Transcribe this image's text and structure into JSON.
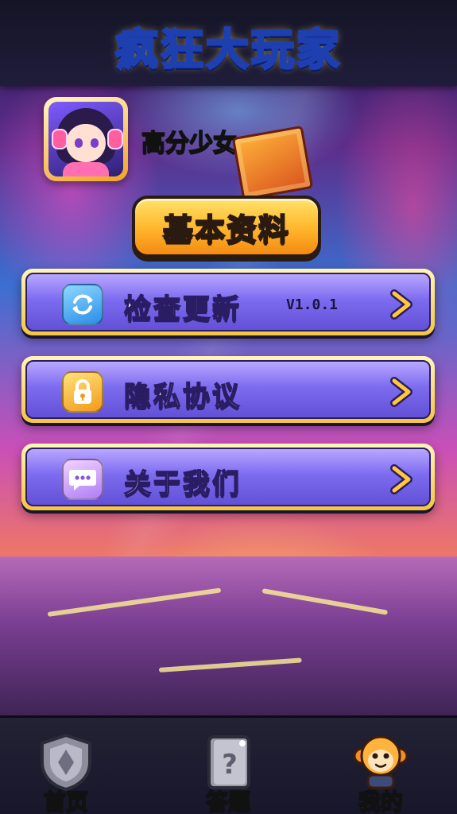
{
  "header": {
    "title": "疯狂大玩家"
  },
  "profile": {
    "username": "高分少女",
    "basic_info_label": "基本资料"
  },
  "menu": [
    {
      "label": "检查更新",
      "extra": "V1.0.1",
      "icon": "refresh-icon",
      "icon_color": "#3aa6f5"
    },
    {
      "label": "隐私协议",
      "extra": "",
      "icon": "lock-icon",
      "icon_color": "#ffbf2b"
    },
    {
      "label": "关于我们",
      "extra": "",
      "icon": "chat-icon",
      "icon_color": "#c58bff"
    }
  ],
  "bottom_nav": [
    {
      "label": "首页",
      "icon": "home-shield-icon",
      "active": false
    },
    {
      "label": "答题",
      "icon": "quiz-book-icon",
      "active": false
    },
    {
      "label": "我的",
      "icon": "monkey-avatar-icon",
      "active": true
    }
  ],
  "colors": {
    "title_fill": "#ffd34d",
    "title_stroke": "#1d3fb0",
    "menu_frame": "#f3c640",
    "menu_fill": "#7d6cf0",
    "button_orange": "#ffb52b",
    "nav_bg": "#17162a"
  }
}
